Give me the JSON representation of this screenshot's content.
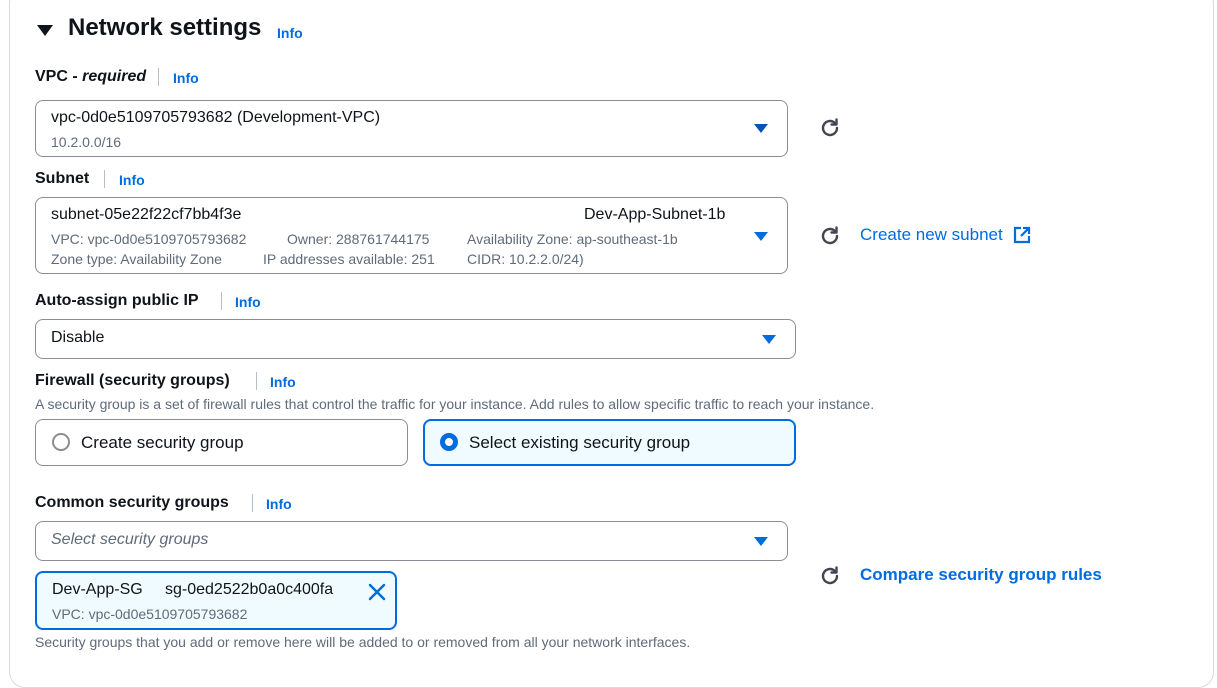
{
  "section": {
    "title": "Network settings",
    "info": "Info"
  },
  "vpc": {
    "label_main": "VPC - ",
    "label_req": "required",
    "info": "Info",
    "value": "vpc-0d0e5109705793682 (Development-VPC)",
    "cidr": "10.2.0.0/16"
  },
  "subnet": {
    "label": "Subnet",
    "info": "Info",
    "id": "subnet-05e22f22cf7bb4f3e",
    "name": "Dev-App-Subnet-1b",
    "vpc": "VPC: vpc-0d0e5109705793682",
    "owner": "Owner: 288761744175",
    "az": "Availability Zone: ap-southeast-1b",
    "zone_type": "Zone type: Availability Zone",
    "ips": "IP addresses available: 251",
    "cidr": "CIDR: 10.2.2.0/24)",
    "create_link": "Create new subnet"
  },
  "public_ip": {
    "label": "Auto-assign public IP",
    "info": "Info",
    "value": "Disable"
  },
  "firewall": {
    "label": "Firewall (security groups)",
    "info": "Info",
    "description": "A security group is a set of firewall rules that control the traffic for your instance. Add rules to allow specific traffic to reach your instance.",
    "option_create": "Create security group",
    "option_select": "Select existing security group",
    "selected": "select"
  },
  "common_sg": {
    "label": "Common security groups",
    "info": "Info",
    "placeholder": "Select security groups",
    "compare_link": "Compare security group rules",
    "token": {
      "name": "Dev-App-SG",
      "id": "sg-0ed2522b0a0c400fa",
      "vpc": "VPC: vpc-0d0e5109705793682"
    },
    "footer": "Security groups that you add or remove here will be added to or removed from all your network interfaces."
  },
  "icons": {
    "collapse": "caret-down-icon",
    "refresh": "refresh-icon",
    "external": "external-link-icon",
    "remove": "close-icon"
  },
  "colors": {
    "link": "#006ce0",
    "selected_border": "#006ce0",
    "selected_bg": "#f0fbff"
  }
}
